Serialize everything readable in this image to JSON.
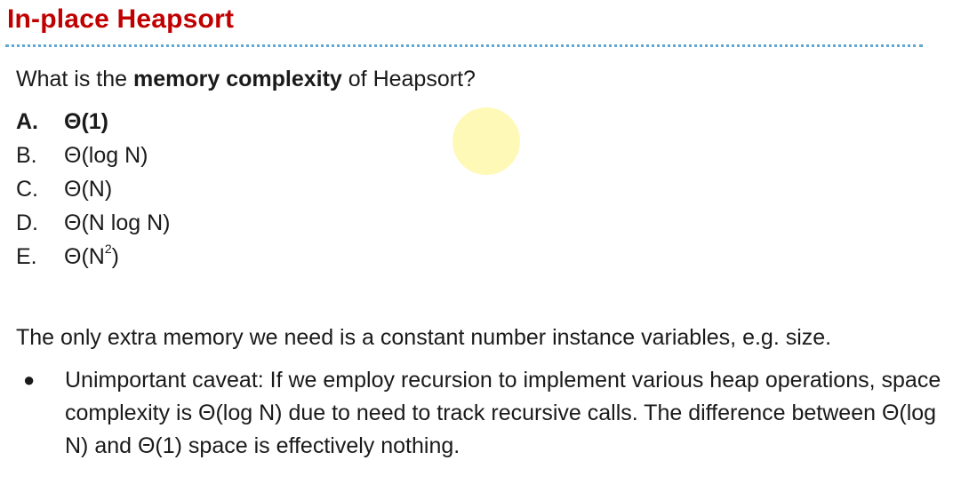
{
  "slide": {
    "title": "In-place Heapsort"
  },
  "question": {
    "prefix": "What is the ",
    "emphasis": "memory complexity",
    "suffix": " of Heapsort?"
  },
  "options": [
    {
      "letter": "A.",
      "text": "Θ(1)",
      "correct": true
    },
    {
      "letter": "B.",
      "text": "Θ(log N)",
      "correct": false
    },
    {
      "letter": "C.",
      "text": "Θ(N)",
      "correct": false
    },
    {
      "letter": "D.",
      "text": "Θ(N log N)",
      "correct": false
    },
    {
      "letter": "E.",
      "text_base": "Θ(N",
      "text_sup": "2",
      "text_end": ")",
      "correct": false
    }
  ],
  "explanation": "The only extra memory we need is a constant number instance variables, e.g. size.",
  "bullet": {
    "marker": "●",
    "text": "Unimportant caveat: If we employ recursion to implement various heap operations, space complexity is Θ(log N) due to need to track recursive calls. The difference between Θ(log N) and Θ(1) space is effectively nothing."
  },
  "colors": {
    "title": "#c00000",
    "rule": "#5fa8d3",
    "pointer": "#fff9b3"
  }
}
